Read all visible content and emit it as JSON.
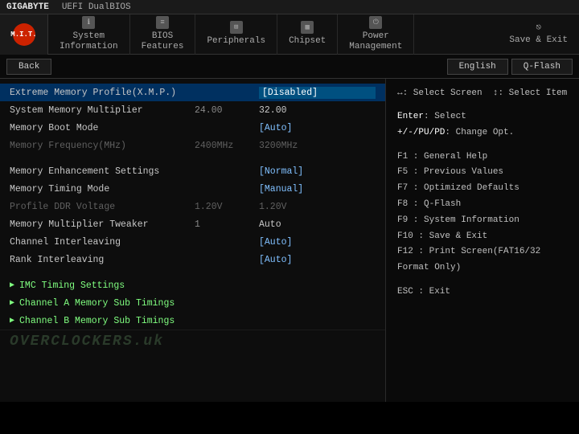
{
  "topbar": {
    "brand": "GIGABYTE",
    "sub": "UEFI DualBIOS"
  },
  "nav": {
    "mit_label": "M.I.T.",
    "items": [
      {
        "id": "system-information",
        "icon": "ℹ",
        "line1": "System",
        "line2": "Information"
      },
      {
        "id": "bios-features",
        "icon": "≡",
        "line1": "BIOS",
        "line2": "Features"
      },
      {
        "id": "peripherals",
        "icon": "⊞",
        "line1": "",
        "line2": "Peripherals"
      },
      {
        "id": "chipset",
        "icon": "▦",
        "line1": "",
        "line2": "Chipset"
      },
      {
        "id": "power-management",
        "icon": "⏻",
        "line1": "Power",
        "line2": "Management"
      }
    ],
    "save_exit": {
      "line1": "",
      "line2": "Save & Exit"
    }
  },
  "actionbar": {
    "back_label": "Back",
    "lang_label": "English",
    "qflash_label": "Q-Flash"
  },
  "settings": [
    {
      "id": "xmp",
      "name": "Extreme Memory Profile(X.M.P.)",
      "val_left": "",
      "val_right": "[Disabled]",
      "type": "selected",
      "dimmed": false
    },
    {
      "id": "mem-mult",
      "name": "System Memory Multiplier",
      "val_left": "24.00",
      "val_right": "32.00",
      "type": "plain",
      "dimmed": false
    },
    {
      "id": "boot-mode",
      "name": "Memory Boot Mode",
      "val_left": "",
      "val_right": "[Auto]",
      "type": "bracket",
      "dimmed": false
    },
    {
      "id": "mem-freq",
      "name": "Memory Frequency(MHz)",
      "val_left": "2400MHz",
      "val_right": "3200MHz",
      "type": "dimmed",
      "dimmed": true
    },
    {
      "id": "spacer1",
      "type": "spacer"
    },
    {
      "id": "mem-enhance",
      "name": "Memory Enhancement Settings",
      "val_left": "",
      "val_right": "[Normal]",
      "type": "bracket",
      "dimmed": false
    },
    {
      "id": "timing-mode",
      "name": "Memory Timing Mode",
      "val_left": "",
      "val_right": "[Manual]",
      "type": "bracket",
      "dimmed": false
    },
    {
      "id": "ddr-voltage",
      "name": "Profile DDR Voltage",
      "val_left": "1.20V",
      "val_right": "1.20V",
      "type": "dimmed",
      "dimmed": true
    },
    {
      "id": "mult-tweaker",
      "name": "Memory Multiplier Tweaker",
      "val_left": "1",
      "val_right": "Auto",
      "type": "plain",
      "dimmed": false
    },
    {
      "id": "ch-interleave",
      "name": "Channel Interleaving",
      "val_left": "",
      "val_right": "[Auto]",
      "type": "bracket",
      "dimmed": false
    },
    {
      "id": "rank-interleave",
      "name": "Rank Interleaving",
      "val_left": "",
      "val_right": "[Auto]",
      "type": "bracket",
      "dimmed": false
    },
    {
      "id": "spacer2",
      "type": "spacer"
    }
  ],
  "submenus": [
    {
      "id": "imc-timing",
      "label": "IMC Timing Settings"
    },
    {
      "id": "ch-a-sub",
      "label": "Channel A Memory Sub Timings"
    },
    {
      "id": "ch-b-sub",
      "label": "Channel B Memory Sub Timings"
    }
  ],
  "watermark": {
    "text": "OVERCLOCKERS.uk"
  },
  "help": {
    "nav_hint": "↔: Select Screen  ↕: Select Item",
    "enter": "Enter: Select",
    "change": "+/-/PU/PD: Change Opt.",
    "f1": "F1   : General Help",
    "f5": "F5   : Previous Values",
    "f7": "F7   : Optimized Defaults",
    "f8": "F8   : Q-Flash",
    "f9": "F9   : System Information",
    "f10": "F10  : Save & Exit",
    "f12": "F12  : Print Screen(FAT16/32 Format Only)",
    "esc": "ESC  : Exit"
  }
}
